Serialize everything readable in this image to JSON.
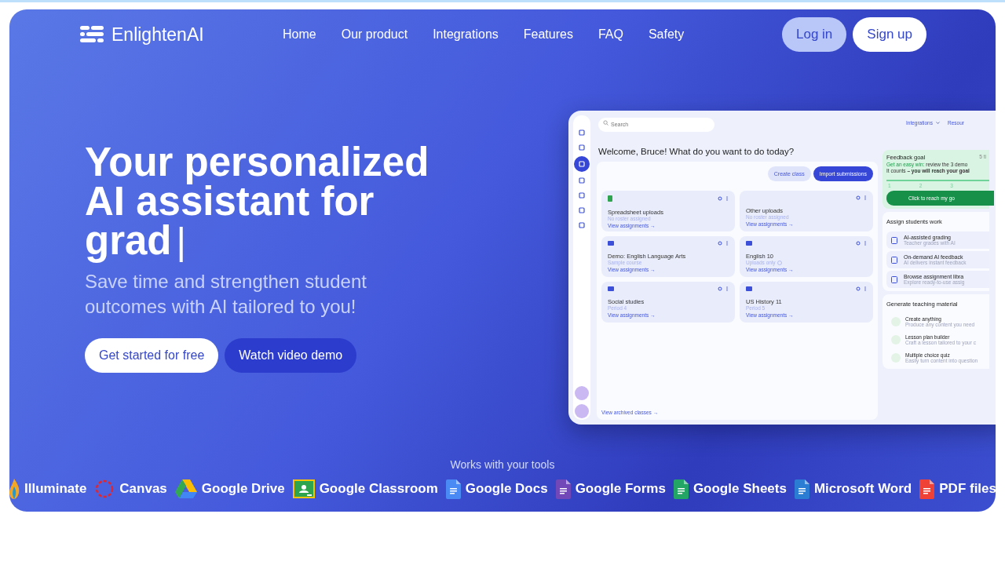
{
  "brand": "EnlightenAI",
  "nav": [
    {
      "label": "Home"
    },
    {
      "label": "Our product"
    },
    {
      "label": "Integrations"
    },
    {
      "label": "Features"
    },
    {
      "label": "FAQ"
    },
    {
      "label": "Safety"
    }
  ],
  "auth": [
    {
      "label": "Log in",
      "kind": "soft"
    },
    {
      "label": "Sign up",
      "kind": "solid"
    }
  ],
  "hero": {
    "title_lines": [
      "Your personalized",
      "AI assistant for",
      "grad"
    ],
    "cursor": "|",
    "subtitle": "Save time and strengthen student outcomes with AI tailored to you!",
    "buttons": [
      {
        "label": "Get started for free",
        "kind": "solid"
      },
      {
        "label": "Watch video demo",
        "kind": "dark"
      }
    ]
  },
  "app": {
    "sidebar": [
      {
        "selected": false
      },
      {
        "selected": false
      },
      {
        "selected": true
      },
      {
        "selected": false
      },
      {
        "selected": false
      },
      {
        "selected": false
      },
      {
        "selected": false
      }
    ],
    "search": {
      "placeholder": "Search"
    },
    "topnav": [
      {
        "label": "Integrations",
        "dropdown": true
      },
      {
        "label": "Resour",
        "dropdown": false
      }
    ],
    "welcome": "Welcome, Bruce! What do you want to do today?",
    "actions": [
      {
        "label": "Create class",
        "kind": "soft"
      },
      {
        "label": "Import submissions",
        "kind": "solid"
      }
    ],
    "classes": [
      {
        "kind": "sheet",
        "title": "Spreadsheet uploads",
        "subtitle": "No roster assigned",
        "info": false,
        "link": "View assignments →"
      },
      {
        "kind": "other",
        "title": "Other uploads",
        "subtitle": "No roster assigned",
        "info": false,
        "link": "View assignments →"
      },
      {
        "kind": "class",
        "title": "Demo: English Language Arts",
        "subtitle": "Sample course",
        "info": false,
        "link": "View assignments →"
      },
      {
        "kind": "class",
        "title": "English 10",
        "subtitle": "Uploads only",
        "info": true,
        "link": "View assignments →"
      },
      {
        "kind": "class",
        "title": "Social studies",
        "subtitle": "Period 4",
        "info": false,
        "link": "View assignments →"
      },
      {
        "kind": "class",
        "title": "US History 11",
        "subtitle": "Period 5",
        "info": false,
        "link": "View assignments →"
      }
    ],
    "archived": "View archived classes →",
    "goal": {
      "title": "Feedback goal",
      "count": "5 ti",
      "highlight": "Get an easy win:",
      "text": "review the 3 demo",
      "note": "It counts **– you will reach your goal**",
      "steps": [
        "1",
        "2",
        "3"
      ],
      "button": "Click to reach my go"
    },
    "assign": {
      "title": "Assign students work",
      "items": [
        {
          "title": "AI-assisted grading",
          "desc": "Teacher grades with AI"
        },
        {
          "title": "On-demand AI feedback",
          "desc": "AI delivers instant feedback"
        },
        {
          "title": "Browse assignment libra",
          "desc": "Explore ready-to-use assig"
        }
      ]
    },
    "generate": {
      "title": "Generate teaching material",
      "items": [
        {
          "title": "Create anything",
          "desc": "Produce any content you need"
        },
        {
          "title": "Lesson plan builder",
          "desc": "Craft a lesson tailored to your c"
        },
        {
          "title": "Multiple choice quiz",
          "desc": "Easily turn content into question"
        }
      ]
    }
  },
  "tools_heading": "Works with your tools",
  "tools": [
    {
      "name": "Illuminate",
      "kind": "flame",
      "color": "#f5a623"
    },
    {
      "name": "Canvas",
      "kind": "ring",
      "color": "#e0262e"
    },
    {
      "name": "Google Drive",
      "kind": "triangle",
      "color": "#34a853"
    },
    {
      "name": "Google Classroom",
      "kind": "board",
      "color": "#2ea44f"
    },
    {
      "name": "Google Docs",
      "kind": "doc",
      "color": "#4a8af4"
    },
    {
      "name": "Google Forms",
      "kind": "doc",
      "color": "#7248b9"
    },
    {
      "name": "Google Sheets",
      "kind": "doc",
      "color": "#23a566"
    },
    {
      "name": "Microsoft Word",
      "kind": "doc",
      "color": "#2b7cd3"
    },
    {
      "name": "PDF files",
      "kind": "doc",
      "color": "#ef4136"
    }
  ]
}
